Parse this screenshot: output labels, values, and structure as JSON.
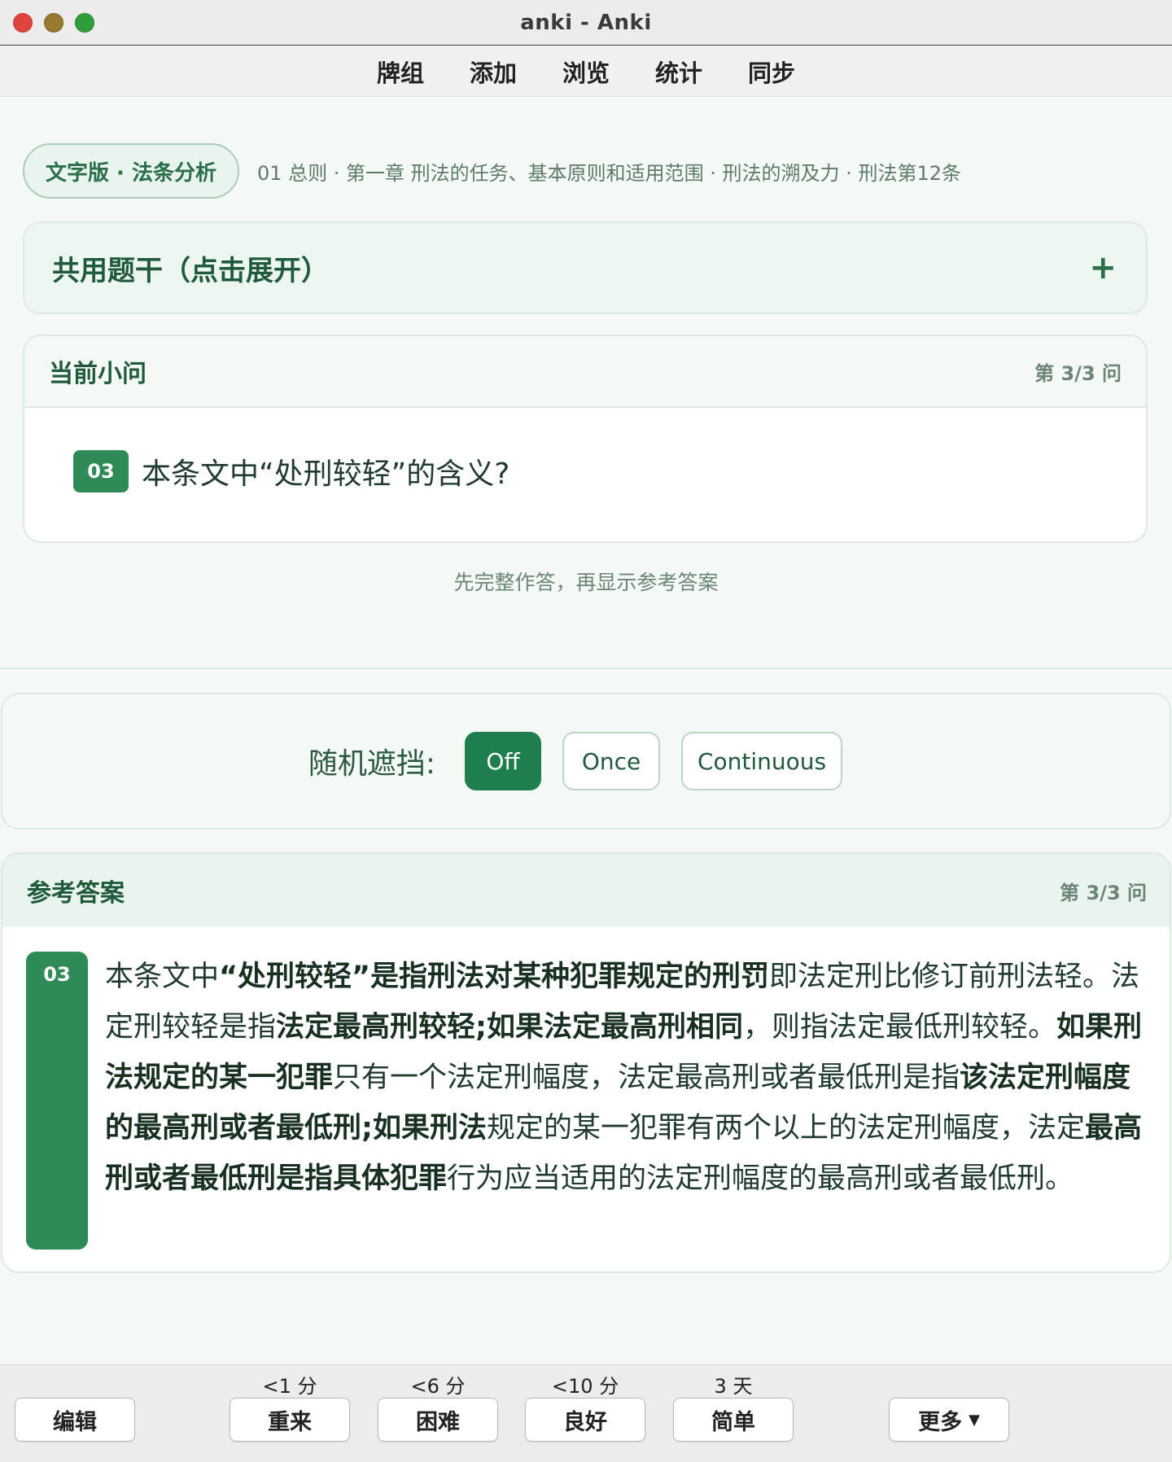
{
  "window": {
    "title": "anki - Anki"
  },
  "toolbar": {
    "items": [
      "牌组",
      "添加",
      "浏览",
      "统计",
      "同步"
    ]
  },
  "card": {
    "tag": "文字版 · 法条分析",
    "breadcrumb": "01 总则 · 第一章 刑法的任务、基本原则和适用范围 · 刑法的溯及力 · 刑法第12条",
    "stem_title": "共用题干（点击展开）",
    "question_header": "当前小问",
    "question_counter": "第 3/3 问",
    "question_number": "03",
    "question_text": "本条文中“处刑较轻”的含义?",
    "hint": "先完整作答，再显示参考答案"
  },
  "mask": {
    "label": "随机遮挡:",
    "options": [
      "Off",
      "Once",
      "Continuous"
    ],
    "selected": "Off"
  },
  "answer": {
    "header": "参考答案",
    "counter": "第 3/3 问",
    "number": "03",
    "segments": [
      {
        "t": "本条文中",
        "b": false
      },
      {
        "t": "“处刑较轻”是指刑法对某种犯罪规定的刑罚",
        "b": true
      },
      {
        "t": "即法定刑比修订前刑法轻。法定刑较轻是指",
        "b": false
      },
      {
        "t": "法定最高刑较轻;如果法定最高刑相同",
        "b": true
      },
      {
        "t": "，则指法定最低刑较轻。",
        "b": false
      },
      {
        "t": "如果刑法规定的某一犯罪",
        "b": true
      },
      {
        "t": "只有一个法定刑幅度，法定最高刑或者最低刑是指",
        "b": false
      },
      {
        "t": "该法定刑幅度的最高刑或者最低刑;如果刑法",
        "b": true
      },
      {
        "t": "规定的某一犯罪有两个以上的法定刑幅度，法定",
        "b": false
      },
      {
        "t": "最高刑或者最低刑是指具体犯罪",
        "b": true
      },
      {
        "t": "行为应当适用的法定刑幅度的最高刑或者最低刑。",
        "b": false
      }
    ]
  },
  "bottom": {
    "edit": "编辑",
    "more": "更多",
    "answers": [
      {
        "label": "重来",
        "time": "<1 分"
      },
      {
        "label": "困难",
        "time": "<6 分"
      },
      {
        "label": "良好",
        "time": "<10 分"
      },
      {
        "label": "简单",
        "time": "3 天"
      }
    ]
  },
  "colors": {
    "accent": "#2e8a57",
    "accent_dark": "#1f7e4d",
    "surface": "#f4f9f6"
  }
}
